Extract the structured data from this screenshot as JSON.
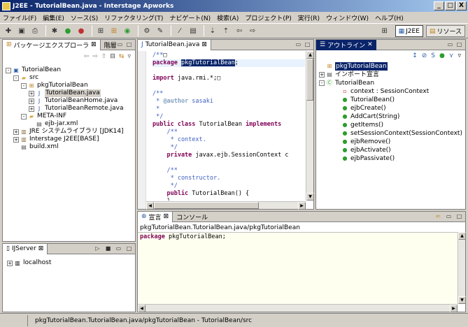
{
  "window": {
    "title": "J2EE - TutorialBean.java - Interstage Apworks",
    "minimize": "_",
    "maximize": "□",
    "close": "X"
  },
  "menu": [
    "ファイル(F)",
    "編集(E)",
    "ソース(S)",
    "リファクタリング(T)",
    "ナビゲート(N)",
    "検索(A)",
    "プロジェクト(P)",
    "実行(R)",
    "ウィンドウ(W)",
    "ヘルプ(H)"
  ],
  "toolbar": {
    "perspective_j2ee": "J2EE",
    "perspective_resource": "リソース"
  },
  "package_explorer": {
    "tab_label": "パッケージエクスプローラ",
    "tab_hierarchy": "階層",
    "tree": [
      {
        "label": "TutorialBean",
        "level": 0,
        "expand": "-",
        "icon": "project"
      },
      {
        "label": "src",
        "level": 1,
        "expand": "-",
        "icon": "folder"
      },
      {
        "label": "pkgTutorialBean",
        "level": 2,
        "expand": "-",
        "icon": "package"
      },
      {
        "label": "TutorialBean.java",
        "level": 3,
        "expand": "+",
        "icon": "java",
        "selected": true
      },
      {
        "label": "TutorialBeanHome.java",
        "level": 3,
        "expand": "+",
        "icon": "java"
      },
      {
        "label": "TutorialBeanRemote.java",
        "level": 3,
        "expand": "+",
        "icon": "java"
      },
      {
        "label": "META-INF",
        "level": 2,
        "expand": "-",
        "icon": "folder"
      },
      {
        "label": "ejb-jar.xml",
        "level": 3,
        "expand": "",
        "icon": "xml"
      },
      {
        "label": "JRE システムライブラリ [JDK14]",
        "level": 1,
        "expand": "+",
        "icon": "lib"
      },
      {
        "label": "Interstage J2EE[BASE]",
        "level": 1,
        "expand": "+",
        "icon": "lib"
      },
      {
        "label": "build.xml",
        "level": 1,
        "expand": "",
        "icon": "xml"
      }
    ]
  },
  "ijserver": {
    "tab_label": "IJServer",
    "tree": [
      {
        "label": "localhost",
        "expand": "+"
      }
    ]
  },
  "editor": {
    "tab_label": "TutorialBean.java",
    "lines": [
      {
        "parts": [
          {
            "t": "/**",
            "c": "cm"
          },
          {
            "t": "□",
            "c": ""
          }
        ]
      },
      {
        "parts": [
          {
            "t": "package ",
            "c": "kw"
          },
          {
            "t": "pkgTutorialBean",
            "c": "hl"
          },
          {
            "t": ";",
            "c": ""
          }
        ]
      },
      {
        "parts": []
      },
      {
        "parts": [
          {
            "t": "import ",
            "c": "kw"
          },
          {
            "t": "java.rmi.*;",
            "c": ""
          },
          {
            "t": "□",
            "c": ""
          }
        ]
      },
      {
        "parts": []
      },
      {
        "parts": [
          {
            "t": "/**",
            "c": "cm"
          }
        ]
      },
      {
        "parts": [
          {
            "t": " * ",
            "c": "cm"
          },
          {
            "t": "@author",
            "c": "ann"
          },
          {
            "t": " sasaki",
            "c": "cm"
          }
        ]
      },
      {
        "parts": [
          {
            "t": " *",
            "c": "cm"
          }
        ]
      },
      {
        "parts": [
          {
            "t": " */",
            "c": "cm"
          }
        ]
      },
      {
        "parts": [
          {
            "t": "public class ",
            "c": "kw"
          },
          {
            "t": "TutorialBean ",
            "c": ""
          },
          {
            "t": "implements",
            "c": "kw"
          }
        ]
      },
      {
        "parts": [
          {
            "t": "    /**",
            "c": "cm"
          }
        ]
      },
      {
        "parts": [
          {
            "t": "     * context.",
            "c": "cm"
          }
        ]
      },
      {
        "parts": [
          {
            "t": "     */",
            "c": "cm"
          }
        ]
      },
      {
        "parts": [
          {
            "t": "    private ",
            "c": "kw"
          },
          {
            "t": "javax.ejb.SessionContext c",
            "c": ""
          }
        ]
      },
      {
        "parts": []
      },
      {
        "parts": [
          {
            "t": "    /**",
            "c": "cm"
          }
        ]
      },
      {
        "parts": [
          {
            "t": "     * constructor.",
            "c": "cm"
          }
        ]
      },
      {
        "parts": [
          {
            "t": "     */",
            "c": "cm"
          }
        ]
      },
      {
        "parts": [
          {
            "t": "    public ",
            "c": "kw"
          },
          {
            "t": "TutorialBean() {",
            "c": ""
          }
        ]
      },
      {
        "parts": [
          {
            "t": "    }",
            "c": ""
          }
        ]
      },
      {
        "parts": []
      },
      {
        "parts": [
          {
            "t": "    /**",
            "c": "cm"
          }
        ]
      }
    ]
  },
  "outline": {
    "tab_label": "アウトライン",
    "items": [
      {
        "label": "pkgTutorialBean",
        "level": 0,
        "icon": "package",
        "selected": true
      },
      {
        "label": "インポート宣言",
        "level": 0,
        "icon": "imports",
        "expand": "+"
      },
      {
        "label": "TutorialBean",
        "level": 0,
        "icon": "class",
        "expand": "-"
      },
      {
        "label": "context : SessionContext",
        "level": 1,
        "icon": "field"
      },
      {
        "label": "TutorialBean()",
        "level": 1,
        "icon": "ctor"
      },
      {
        "label": "ejbCreate()",
        "level": 1,
        "icon": "method"
      },
      {
        "label": "AddCart(String)",
        "level": 1,
        "icon": "method"
      },
      {
        "label": "getItems()",
        "level": 1,
        "icon": "method"
      },
      {
        "label": "setSessionContext(SessionContext)",
        "level": 1,
        "icon": "method"
      },
      {
        "label": "ejbRemove()",
        "level": 1,
        "icon": "method"
      },
      {
        "label": "ejbActivate()",
        "level": 1,
        "icon": "method"
      },
      {
        "label": "ejbPassivate()",
        "level": 1,
        "icon": "method"
      }
    ]
  },
  "declaration": {
    "tab_label": "宣言",
    "tab_console": "コンソール",
    "path": "pkgTutorialBean.TutorialBean.java/pkgTutorialBean",
    "code_kw": "package",
    "code_rest": " pkgTutorialBean;"
  },
  "status": {
    "text": "pkgTutorialBean.TutorialBean.java/pkgTutorialBean - TutorialBean/src"
  },
  "colors": {
    "title_start": "#0a246a",
    "title_end": "#a6caf0",
    "keyword": "#7f0055",
    "comment": "#3f5fbf",
    "selection": "#0a246a",
    "declaration_bg": "#fffff0"
  }
}
